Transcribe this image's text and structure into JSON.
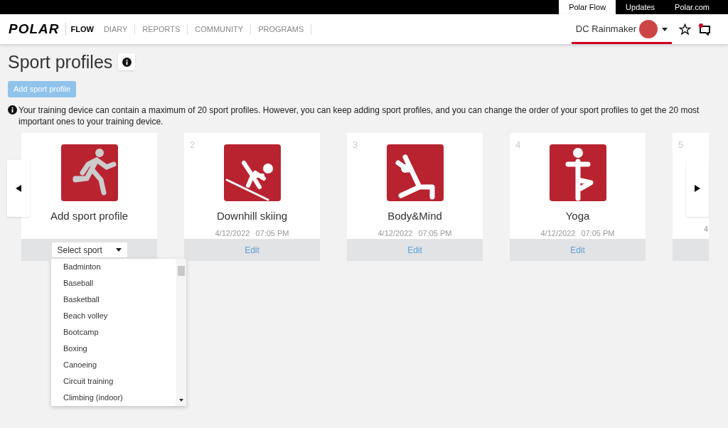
{
  "top_tabs": [
    {
      "label": "Polar Flow",
      "selected": true
    },
    {
      "label": "Updates",
      "selected": false
    },
    {
      "label": "Polar.com",
      "selected": false
    }
  ],
  "nav": {
    "logo": "POLAR",
    "items": [
      {
        "label": "FLOW",
        "selected": true
      },
      {
        "label": "DIARY",
        "selected": false
      },
      {
        "label": "REPORTS",
        "selected": false
      },
      {
        "label": "COMMUNITY",
        "selected": false
      },
      {
        "label": "PROGRAMS",
        "selected": false
      }
    ],
    "user": "DC Rainmaker"
  },
  "page": {
    "title": "Sport profiles",
    "add_button": {
      "label": "Add sport profile",
      "disabled": true
    },
    "notice": "Your training device can contain a maximum of 20 sport profiles. However, you can keep adding sport profiles, and you can change the order of your sport profiles to get the 20 most important ones to your training device."
  },
  "cards": [
    {
      "kind": "add",
      "title": "Add sport profile",
      "select": {
        "placeholder": "Select sport"
      }
    },
    {
      "kind": "profile",
      "number": "2",
      "title": "Downhill skiing",
      "date": "4/12/2022",
      "time": "07:05 PM",
      "action": "Edit"
    },
    {
      "kind": "profile",
      "number": "3",
      "title": "Body&Mind",
      "date": "4/12/2022",
      "time": "07:05 PM",
      "action": "Edit"
    },
    {
      "kind": "profile",
      "number": "4",
      "title": "Yoga",
      "date": "4/12/2022",
      "time": "07:05 PM",
      "action": "Edit"
    },
    {
      "kind": "partial",
      "number": "5",
      "date": "4"
    }
  ],
  "dropdown": {
    "options": [
      "Badminton",
      "Baseball",
      "Basketball",
      "Beach volley",
      "Bootcamp",
      "Boxing",
      "Canoeing",
      "Circuit training",
      "Climbing (indoor)"
    ]
  }
}
